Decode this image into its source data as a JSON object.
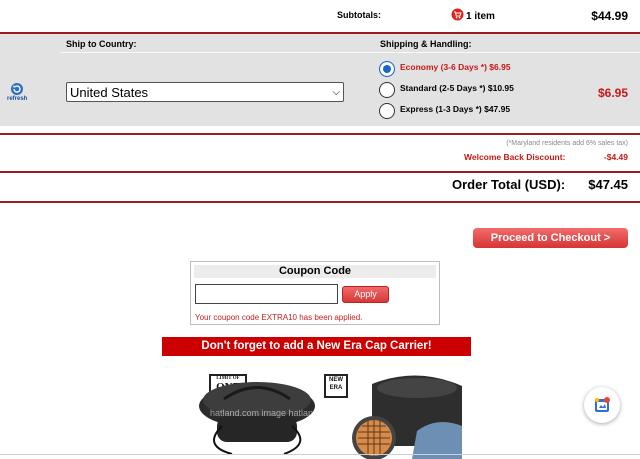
{
  "subtotal": {
    "label": "Subtotals:",
    "items": "1 item",
    "amount": "$44.99"
  },
  "shipping": {
    "country_header": "Ship to Country:",
    "handling_header": "Shipping & Handling:",
    "refresh_label": "refresh",
    "country_value": "United States",
    "options": [
      {
        "label": "Economy (3-6 Days *) $6.95",
        "selected": true
      },
      {
        "label": "Standard (2-5 Days *) $10.95",
        "selected": false
      },
      {
        "label": "Express (1-3 Days *) $47.95",
        "selected": false
      }
    ],
    "amount": "$6.95"
  },
  "tax": {
    "note": "(*Maryland residents add 6% sales tax)"
  },
  "discount": {
    "label": "Welcome Back Discount:",
    "amount": "-$4.49"
  },
  "total": {
    "label": "Order Total (USD):",
    "amount": "$47.45"
  },
  "checkout": {
    "label": "Proceed to Checkout >"
  },
  "coupon": {
    "title": "Coupon Code",
    "input_value": "",
    "apply_label": "Apply",
    "message": "Your coupon code EXTRA10 has been applied."
  },
  "promo": {
    "banner": "Don't forget to add a New Era Cap Carrier!",
    "badge_line1": "LIMIT OF",
    "badge_line2": "ONE",
    "badge_line3": "PER ORDER",
    "brand_line1": "NEW",
    "brand_line2": "ERA",
    "watermark": "hatland.com image   hatland.com image"
  },
  "colors": {
    "accent_red": "#cc0000",
    "rule_red": "#9b1c1c",
    "radio_selected": "#1b65c9",
    "panel_gray": "#e2e2e2"
  },
  "icons": {
    "cart": "cart-icon",
    "refresh": "refresh-icon",
    "select_chevron": "chevron-down-icon",
    "widget": "assistant-icon"
  }
}
